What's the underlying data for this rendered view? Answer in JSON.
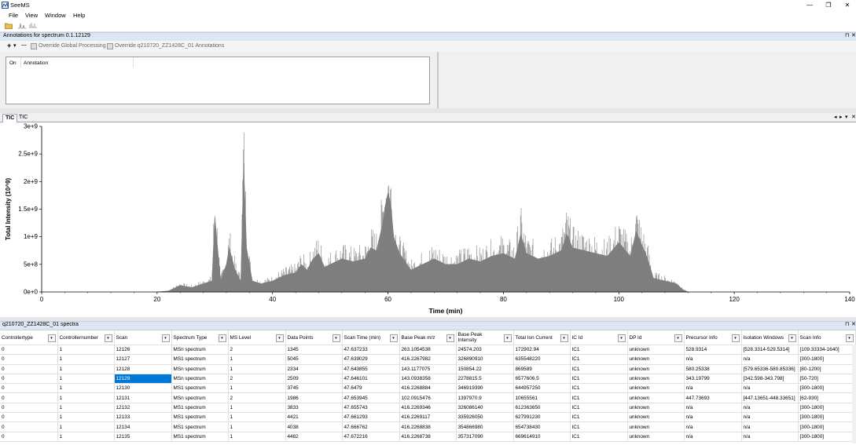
{
  "app": {
    "title": "SeeMS"
  },
  "window_controls": {
    "minimize": "—",
    "restore": "❐",
    "close": "✕"
  },
  "menu": [
    "File",
    "View",
    "Window",
    "Help"
  ],
  "annotations": {
    "title": "Annotations for spectrum 0.1.12129",
    "add": "+",
    "dropdown": "▾",
    "remove": "—",
    "override_global": "Override Global Processing",
    "override_annotations": "Override q210720_ZZ1428C_01 Annotations",
    "columns": [
      "On",
      "Annotation"
    ]
  },
  "panel_controls": {
    "pin": "⊓",
    "close": "✕",
    "left": "◂",
    "right": "▸",
    "menu": "▾"
  },
  "tic": {
    "tabs": [
      "TIC",
      "TIC"
    ]
  },
  "chart_data": {
    "type": "area",
    "xlabel": "Time (min)",
    "ylabel": "Total Intensity (10^9)",
    "xlim": [
      0,
      140
    ],
    "ylim": [
      0,
      3000000000
    ],
    "xticks": [
      "0",
      "20",
      "40",
      "60",
      "80",
      "100",
      "120",
      "140"
    ],
    "yticks": [
      "0e+0",
      "5e+8",
      "1e+9",
      "1.5e+9",
      "2e+9",
      "2.5e+9",
      "3e+9"
    ],
    "color": "#7f7f7f",
    "x": [
      20,
      22,
      24,
      26,
      28,
      29.5,
      30,
      31,
      32,
      32.5,
      33.5,
      34.5,
      35,
      35.5,
      36.5,
      38,
      40,
      42,
      44,
      45,
      46,
      47,
      48,
      49,
      50,
      52,
      54,
      56,
      57,
      58,
      59,
      59.5,
      60,
      60.5,
      61,
      62,
      63,
      64,
      66,
      68,
      70,
      72,
      74,
      76,
      78,
      80,
      82,
      83,
      84,
      86,
      88,
      90,
      91,
      92,
      94,
      96,
      98,
      100,
      102,
      103,
      104,
      105,
      106,
      108,
      110,
      111,
      112
    ],
    "y": [
      0,
      20000000,
      120000000,
      80000000,
      150000000,
      200000000,
      1380000000,
      200000000,
      500000000,
      800000000,
      400000000,
      200000000,
      2330000000,
      800000000,
      200000000,
      150000000,
      200000000,
      300000000,
      350000000,
      500000000,
      400000000,
      600000000,
      700000000,
      450000000,
      500000000,
      600000000,
      550000000,
      600000000,
      800000000,
      750000000,
      1200000000,
      1550000000,
      1800000000,
      1600000000,
      1000000000,
      700000000,
      550000000,
      400000000,
      500000000,
      600000000,
      500000000,
      500000000,
      600000000,
      550000000,
      650000000,
      700000000,
      600000000,
      1050000000,
      700000000,
      600000000,
      650000000,
      750000000,
      1050000000,
      800000000,
      750000000,
      700000000,
      650000000,
      900000000,
      650000000,
      1100000000,
      850000000,
      600000000,
      250000000,
      200000000,
      150000000,
      50000000,
      0
    ]
  },
  "spectra": {
    "title": "q210720_ZZ1428C_01 spectra",
    "columns": [
      "Controllertype",
      "Controllernumber",
      "Scan",
      "Spectrum Type",
      "MS Level",
      "Data Points",
      "Scan Time (min)",
      "Base Peak m/z",
      "Base Peak Intensity",
      "Total Ion Current",
      "IC Id",
      "DP Id",
      "Precursor Info",
      "Isolation Windows",
      "Scan Info"
    ],
    "rows": [
      [
        "0",
        "1",
        "12126",
        "MSn spectrum",
        "2",
        "1345",
        "47.637233",
        "263.1054538",
        "24574.203",
        "172902.94",
        "IC1",
        "unknown",
        "528.9314",
        "[528.3314-529.5314]",
        "[109.33334-1640]"
      ],
      [
        "0",
        "1",
        "12127",
        "MS1 spectrum",
        "1",
        "5045",
        "47.639029",
        "416.2267982",
        "326890910",
        "635548220",
        "IC1",
        "unknown",
        "n/a",
        "n/a",
        "[300-1800]"
      ],
      [
        "0",
        "1",
        "12128",
        "MSn spectrum",
        "1",
        "2334",
        "47.643855",
        "143.1177075",
        "150854.22",
        "869589",
        "IC1",
        "unknown",
        "580.25338",
        "[579.65336-580.85336]",
        "[80-1200]"
      ],
      [
        "0",
        "1",
        "12129",
        "MSn spectrum",
        "2",
        "2509",
        "47.646101",
        "143.0938358",
        "2278815.5",
        "6577606.5",
        "IC1",
        "unknown",
        "343.19799",
        "[342.598-343.798]",
        "[50-720]"
      ],
      [
        "0",
        "1",
        "12130",
        "MS1 spectrum",
        "1",
        "3745",
        "47.6479",
        "416.2268884",
        "346919390",
        "644957250",
        "IC1",
        "unknown",
        "n/a",
        "n/a",
        "[300-1800]"
      ],
      [
        "0",
        "1",
        "12131",
        "MSn spectrum",
        "2",
        "1986",
        "47.653945",
        "102.0915476",
        "1397970.9",
        "10655561",
        "IC1",
        "unknown",
        "447.73693",
        "[447.13651-448.33651]",
        "[62-930]"
      ],
      [
        "0",
        "1",
        "12132",
        "MS1 spectrum",
        "1",
        "3833",
        "47.655743",
        "416.2269346",
        "326086140",
        "612363650",
        "IC1",
        "unknown",
        "n/a",
        "n/a",
        "[300-1800]"
      ],
      [
        "0",
        "1",
        "12133",
        "MS1 spectrum",
        "1",
        "4421",
        "47.661293",
        "416.2269117",
        "335926050",
        "627991230",
        "IC1",
        "unknown",
        "n/a",
        "n/a",
        "[300-1800]"
      ],
      [
        "0",
        "1",
        "12134",
        "MS1 spectrum",
        "1",
        "4038",
        "47.666762",
        "416.2268838",
        "354866980",
        "654738430",
        "IC1",
        "unknown",
        "n/a",
        "n/a",
        "[300-1800]"
      ],
      [
        "0",
        "1",
        "12135",
        "MS1 spectrum",
        "1",
        "4482",
        "47.672216",
        "416.2268738",
        "357317090",
        "669614910",
        "IC1",
        "unknown",
        "n/a",
        "n/a",
        "[300-1800]"
      ]
    ],
    "selected": {
      "row": 3,
      "col": 2
    }
  }
}
